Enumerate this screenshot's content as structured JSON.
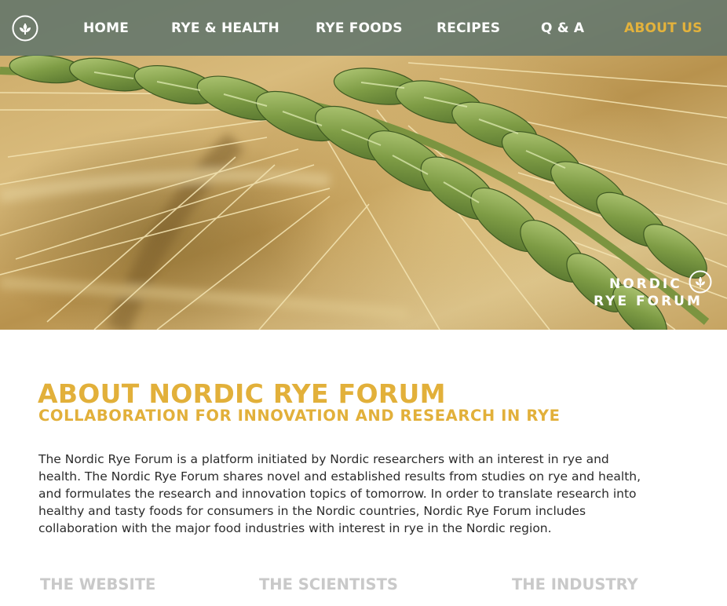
{
  "nav": {
    "logo_icon": "wheat-circle-logo-icon",
    "items": [
      {
        "label": "HOME"
      },
      {
        "label": "RYE & HEALTH"
      },
      {
        "label": "RYE FOODS"
      },
      {
        "label": "RECIPES"
      },
      {
        "label": "Q & A"
      },
      {
        "label": "ABOUT US",
        "active": true
      }
    ],
    "active_color": "#e3b23c"
  },
  "hero": {
    "image": "rye-ear-photo",
    "brand_line1": "NORDIC",
    "brand_line2": "RYE FORUM",
    "brand_icon": "wheat-circle-logo-icon"
  },
  "content": {
    "title": "ABOUT NORDIC RYE FORUM",
    "subtitle": "COLLABORATION FOR INNOVATION AND RESEARCH IN RYE",
    "body": "The Nordic Rye Forum is a platform initiated by Nordic researchers with an interest in rye and health. The Nordic Rye Forum shares novel and established results from studies on rye and health, and formulates the research and innovation topics of tomorrow. In order to translate research into healthy and tasty foods for consumers in the Nordic countries, Nordic Rye Forum includes collaboration with the major food industries with interest in rye in the Nordic region.",
    "sections": [
      {
        "label": "THE WEBSITE"
      },
      {
        "label": "THE SCIENTISTS"
      },
      {
        "label": "THE INDUSTRY"
      }
    ]
  },
  "colors": {
    "accent": "#e2b03a",
    "nav_background": "#60746c",
    "muted_heading": "#c9c9c9",
    "body_text": "#2b2b2b"
  }
}
